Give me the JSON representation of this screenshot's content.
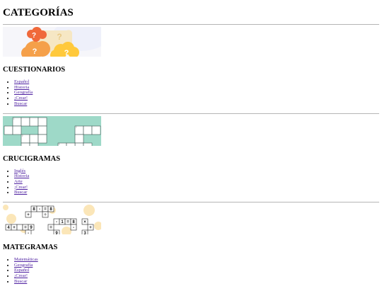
{
  "page_title": "CATEGORÍAS",
  "sections": [
    {
      "heading": "CUESTIONARIOS",
      "banner_icon": "question-marks-illustration",
      "links": [
        "Español",
        "Historia",
        "Geografía",
        "¡Crear!",
        "Buscar"
      ]
    },
    {
      "heading": "CRUCIGRAMAS",
      "banner_icon": "crossword-grid-illustration",
      "links": [
        "Inglés",
        "Historia",
        "Arte",
        "¡Crear!",
        "Buscar"
      ]
    },
    {
      "heading": "MATEGRAMAS",
      "banner_icon": "math-puzzle-illustration",
      "links": [
        "Matemáticas",
        "Geografía",
        "Español",
        "¡Crear!",
        "Buscar"
      ]
    }
  ],
  "puzzle_glyphs": {
    "row1": [
      "8",
      "-",
      "=",
      "8"
    ],
    "row2": [
      "+",
      "÷",
      "×"
    ],
    "row3": [
      "4",
      "+",
      "=",
      "9",
      "-",
      "1",
      "=",
      "8"
    ],
    "row4": [
      "=",
      "-",
      "+"
    ],
    "row5": [
      "-",
      "9",
      "3"
    ]
  },
  "colors": {
    "link": "#4d1fa0",
    "rule": "#b5b5b5",
    "orange_bubble": "#f5a04a",
    "red_bubble": "#f0693a",
    "yellow_bubble": "#ffc93c",
    "cream_bubble": "#f6e7c4",
    "teal": "#9ed9c8",
    "cream_dots": "#fbe6b8"
  }
}
